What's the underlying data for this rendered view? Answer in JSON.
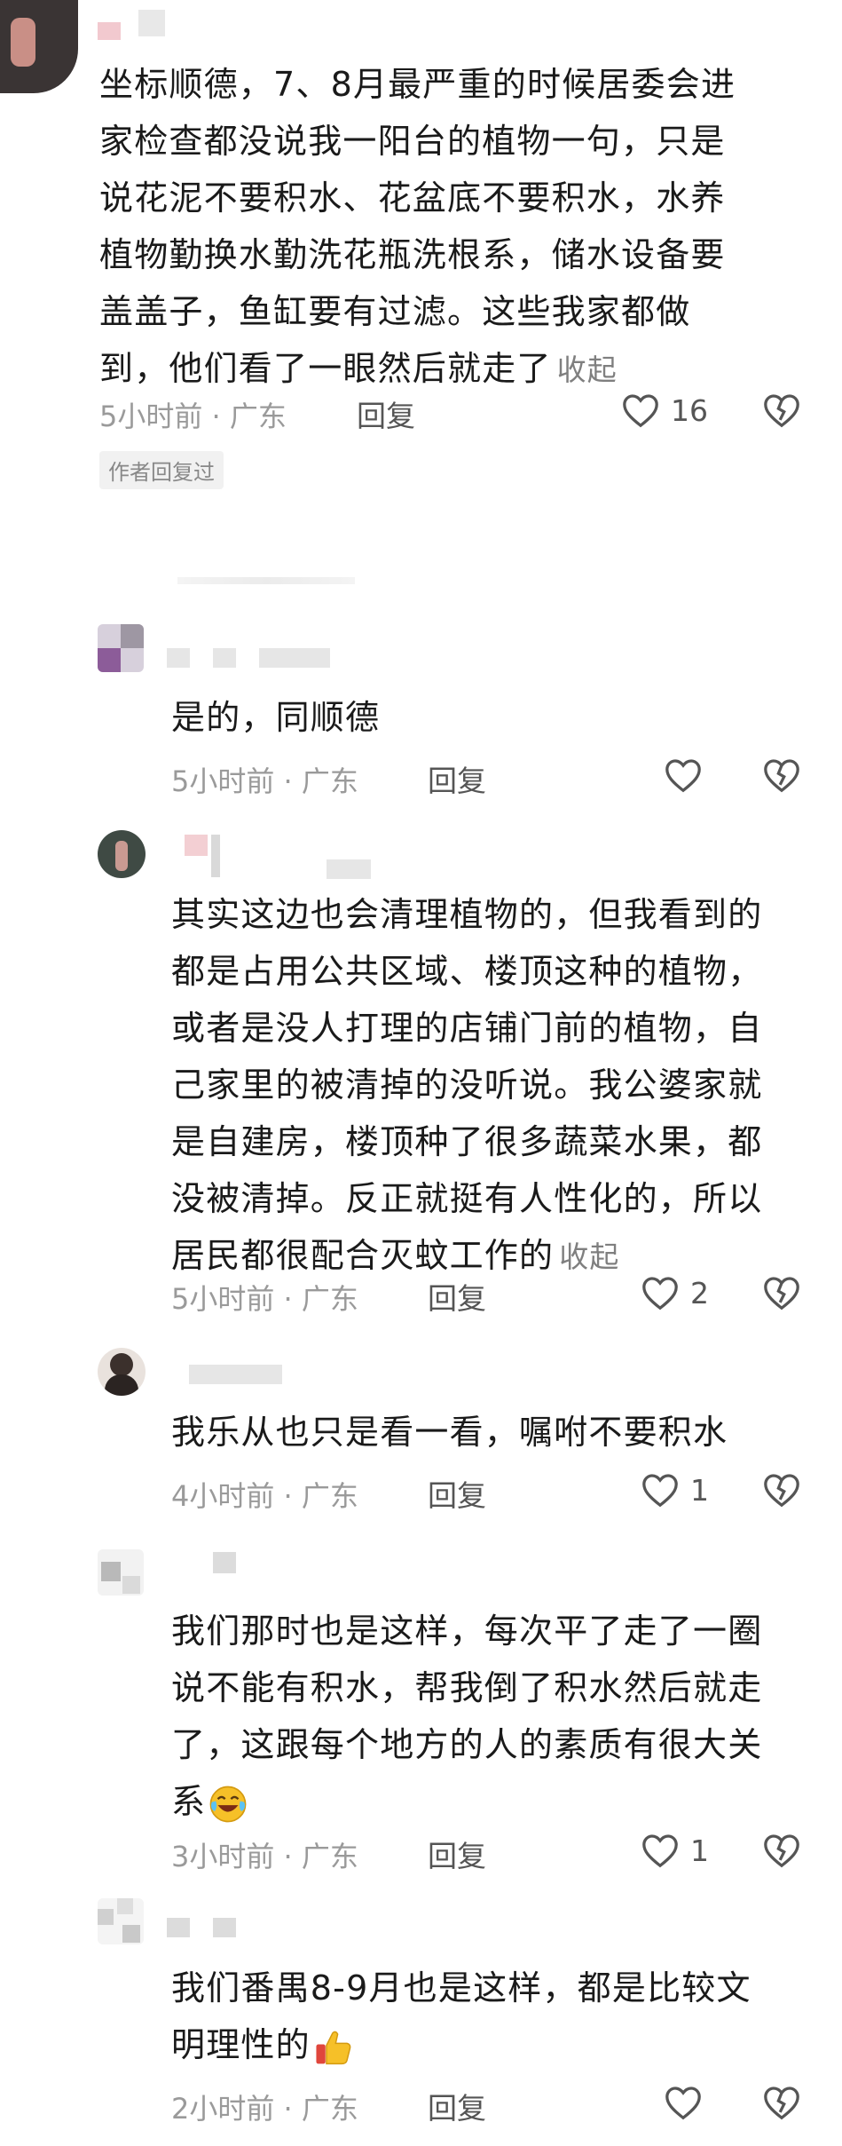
{
  "comments": [
    {
      "lines": [
        "坐标顺德，7、8月最严重的时候居委会进",
        "家检查都没说我一阳台的植物一句，只是",
        "说花泥不要积水、花盆底不要积水，水养",
        "植物勤换水勤洗花瓶洗根系，储水设备要",
        "盖盖子，鱼缸要有过滤。这些我家都做",
        "到，他们看了一眼然后就走了"
      ],
      "collapse": "收起",
      "time": "5小时前 · 广东",
      "reply": "回复",
      "likes": "16",
      "badge": "作者回复过"
    },
    {
      "lines": [
        "是的，同顺德"
      ],
      "time": "5小时前 · 广东",
      "reply": "回复",
      "likes": ""
    },
    {
      "lines": [
        "其实这边也会清理植物的，但我看到的",
        "都是占用公共区域、楼顶这种的植物，",
        "或者是没人打理的店铺门前的植物，自",
        "己家里的被清掉的没听说。我公婆家就",
        "是自建房，楼顶种了很多蔬菜水果，都",
        "没被清掉。反正就挺有人性化的，所以",
        "居民都很配合灭蚊工作的"
      ],
      "collapse": "收起",
      "time": "5小时前 · 广东",
      "reply": "回复",
      "likes": "2"
    },
    {
      "lines": [
        "我乐从也只是看一看，嘱咐不要积水"
      ],
      "time": "4小时前 · 广东",
      "reply": "回复",
      "likes": "1"
    },
    {
      "lines": [
        "我们那时也是这样，每次平了走了一圈",
        "说不能有积水，帮我倒了积水然后就走",
        "了，这跟每个地方的人的素质有很大关",
        "系"
      ],
      "time": "3小时前 · 广东",
      "reply": "回复",
      "likes": "1"
    },
    {
      "lines": [
        "我们番禺8-9月也是这样，都是比较文",
        "明理性的"
      ],
      "time": "2小时前 · 广东",
      "reply": "回复",
      "likes": ""
    }
  ],
  "colors": {
    "meta": "#9a9a9a",
    "text": "#1a1a1a",
    "icon": "#555555"
  }
}
